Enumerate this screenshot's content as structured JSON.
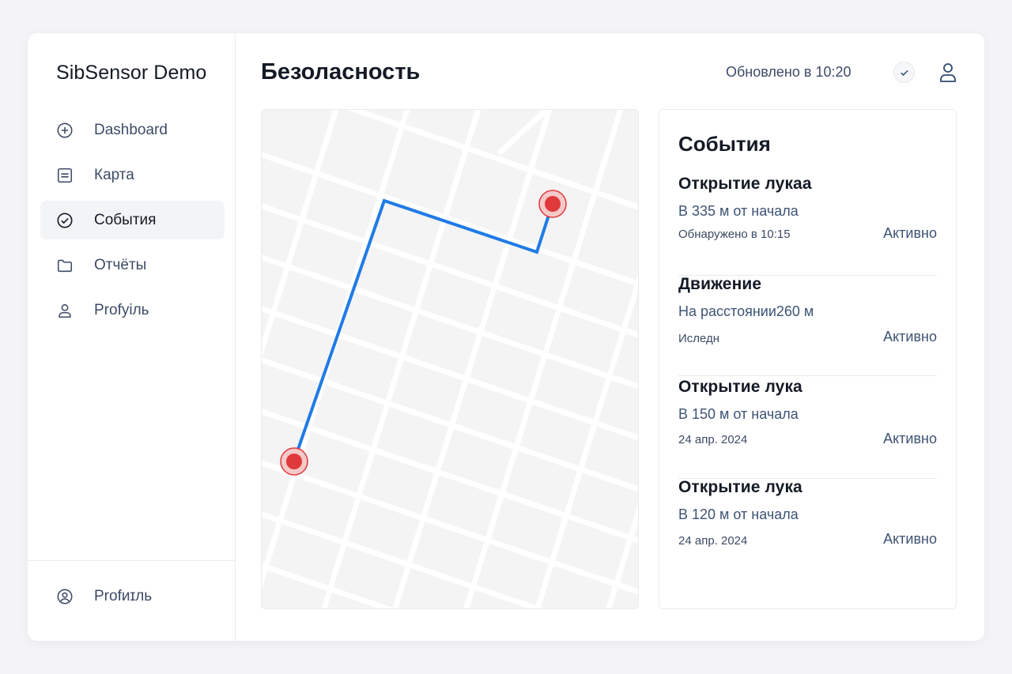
{
  "brand": "SibSensor Demo",
  "sidebar": {
    "items": [
      {
        "label": "Dashboard",
        "icon": "plus-circle-icon"
      },
      {
        "label": "Карта",
        "icon": "list-icon"
      },
      {
        "label": "События",
        "icon": "check-circle-icon",
        "active": true
      },
      {
        "label": "Отчёты",
        "icon": "folder-icon"
      },
      {
        "label": "Profуiль",
        "icon": "user-icon"
      }
    ],
    "footer": {
      "label": "Profиɪль",
      "icon": "user-circle-icon"
    }
  },
  "header": {
    "title": "Безоласность",
    "updated": "Обновлено в 10:20"
  },
  "events": {
    "title": "События",
    "items": [
      {
        "title": "Открытие лукаа",
        "distance": "В 335 м от начала",
        "time": "Обнаружено в 10:15",
        "status": "Активно"
      },
      {
        "title": "Движение",
        "distance": "На расстоянии260 м",
        "time": "Иследн",
        "status": "Активно"
      },
      {
        "title": "Открытие лука",
        "distance": "В 150 м от начала",
        "time": "24 апр. 2024",
        "status": "Активно"
      },
      {
        "title": "Открытие лука",
        "distance": "В 120 м от начала",
        "time": "24 апр. 2024",
        "status": "Активно"
      }
    ]
  },
  "colors": {
    "route": "#1f7be6",
    "marker": "#e0393b",
    "map_bg": "#f4f4f5",
    "street": "#ffffff"
  }
}
